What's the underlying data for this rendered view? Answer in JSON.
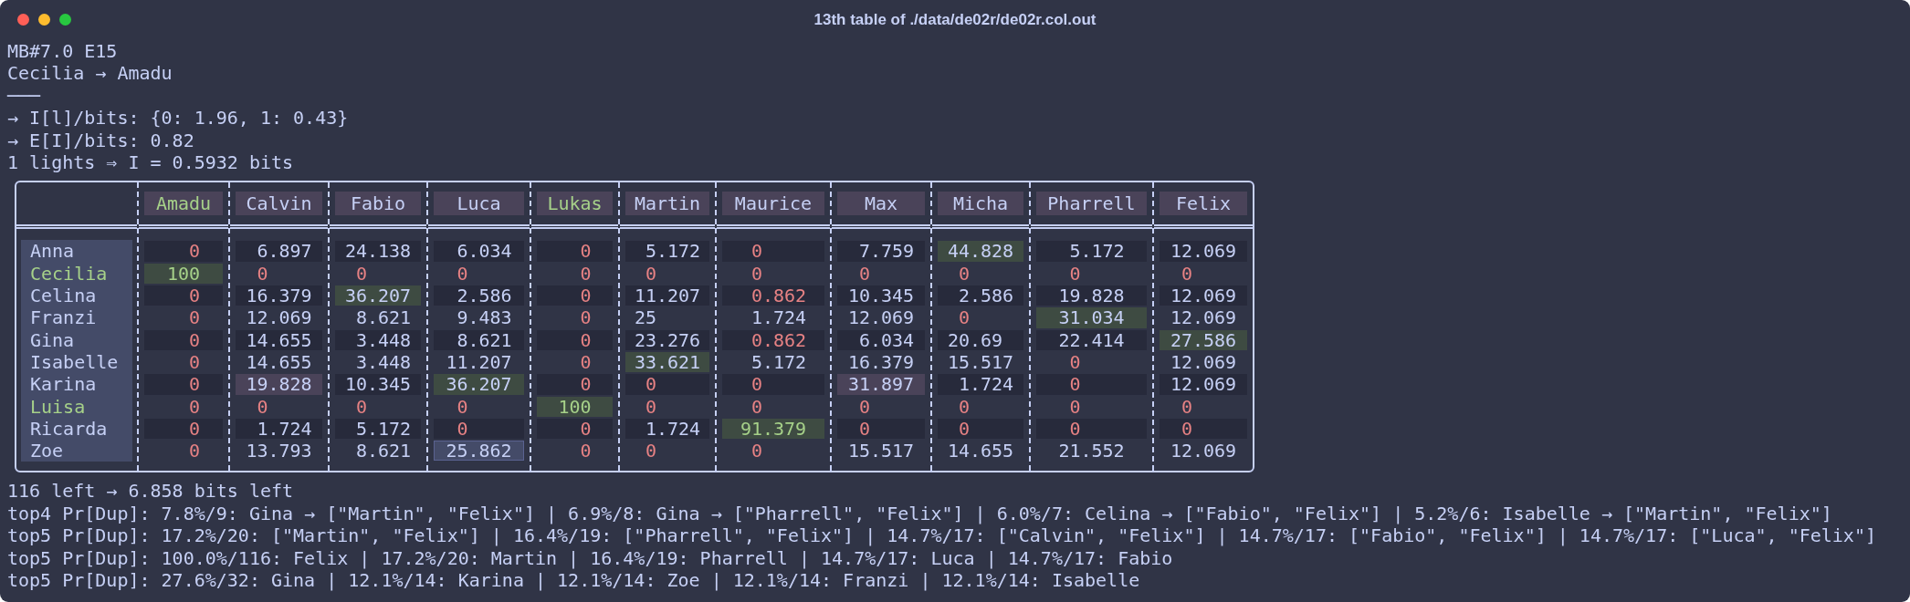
{
  "window": {
    "title": "13th table of ./data/de02r/de02r.col.out"
  },
  "header_lines": [
    "MB#7.0 E15",
    "Cecilia → Amadu",
    "───",
    "→ I[l]/bits: {0: 1.96, 1: 0.43}",
    "→ E[I]/bits: 0.82",
    "1 lights ⇒ I = 0.5932 bits"
  ],
  "table": {
    "columns": [
      {
        "name": "Amadu",
        "match": true
      },
      {
        "name": "Calvin",
        "match": false
      },
      {
        "name": "Fabio",
        "match": false
      },
      {
        "name": "Luca",
        "match": false
      },
      {
        "name": "Lukas",
        "match": true
      },
      {
        "name": "Martin",
        "match": false
      },
      {
        "name": "Maurice",
        "match": false
      },
      {
        "name": "Max",
        "match": false
      },
      {
        "name": "Micha",
        "match": false
      },
      {
        "name": "Pharrell",
        "match": false
      },
      {
        "name": "Felix",
        "match": false
      }
    ],
    "rows": [
      {
        "name": "Anna",
        "match": false,
        "cells": [
          {
            "value": "0",
            "low": true,
            "match": false,
            "best": false,
            "flagged": false,
            "selected": false
          },
          {
            "value": "6.897",
            "low": false,
            "match": false,
            "best": false,
            "flagged": false,
            "selected": false
          },
          {
            "value": "24.138",
            "low": false,
            "match": false,
            "best": false,
            "flagged": false,
            "selected": false
          },
          {
            "value": "6.034",
            "low": false,
            "match": false,
            "best": false,
            "flagged": false,
            "selected": false
          },
          {
            "value": "0",
            "low": true,
            "match": false,
            "best": false,
            "flagged": false,
            "selected": false
          },
          {
            "value": "5.172",
            "low": false,
            "match": false,
            "best": false,
            "flagged": false,
            "selected": false
          },
          {
            "value": "0",
            "low": true,
            "match": false,
            "best": false,
            "flagged": false,
            "selected": false
          },
          {
            "value": "7.759",
            "low": false,
            "match": false,
            "best": false,
            "flagged": false,
            "selected": false
          },
          {
            "value": "44.828",
            "low": false,
            "match": false,
            "best": true,
            "flagged": false,
            "selected": false
          },
          {
            "value": "5.172",
            "low": false,
            "match": false,
            "best": false,
            "flagged": false,
            "selected": false
          },
          {
            "value": "12.069",
            "low": false,
            "match": false,
            "best": false,
            "flagged": false,
            "selected": false
          }
        ]
      },
      {
        "name": "Cecilia",
        "match": true,
        "cells": [
          {
            "value": "100",
            "low": false,
            "match": true,
            "best": true,
            "flagged": false,
            "selected": false
          },
          {
            "value": "0",
            "low": true,
            "match": false,
            "best": false,
            "flagged": false,
            "selected": false
          },
          {
            "value": "0",
            "low": true,
            "match": false,
            "best": false,
            "flagged": false,
            "selected": false
          },
          {
            "value": "0",
            "low": true,
            "match": false,
            "best": false,
            "flagged": false,
            "selected": false
          },
          {
            "value": "0",
            "low": true,
            "match": false,
            "best": false,
            "flagged": false,
            "selected": false
          },
          {
            "value": "0",
            "low": true,
            "match": false,
            "best": false,
            "flagged": false,
            "selected": false
          },
          {
            "value": "0",
            "low": true,
            "match": false,
            "best": false,
            "flagged": false,
            "selected": false
          },
          {
            "value": "0",
            "low": true,
            "match": false,
            "best": false,
            "flagged": false,
            "selected": false
          },
          {
            "value": "0",
            "low": true,
            "match": false,
            "best": false,
            "flagged": false,
            "selected": false
          },
          {
            "value": "0",
            "low": true,
            "match": false,
            "best": false,
            "flagged": false,
            "selected": false
          },
          {
            "value": "0",
            "low": true,
            "match": false,
            "best": false,
            "flagged": false,
            "selected": false
          }
        ]
      },
      {
        "name": "Celina",
        "match": false,
        "cells": [
          {
            "value": "0",
            "low": true,
            "match": false,
            "best": false,
            "flagged": false,
            "selected": false
          },
          {
            "value": "16.379",
            "low": false,
            "match": false,
            "best": false,
            "flagged": false,
            "selected": false
          },
          {
            "value": "36.207",
            "low": false,
            "match": false,
            "best": true,
            "flagged": false,
            "selected": false
          },
          {
            "value": "2.586",
            "low": false,
            "match": false,
            "best": false,
            "flagged": false,
            "selected": false
          },
          {
            "value": "0",
            "low": true,
            "match": false,
            "best": false,
            "flagged": false,
            "selected": false
          },
          {
            "value": "11.207",
            "low": false,
            "match": false,
            "best": false,
            "flagged": false,
            "selected": false
          },
          {
            "value": "0.862",
            "low": true,
            "match": false,
            "best": false,
            "flagged": false,
            "selected": false
          },
          {
            "value": "10.345",
            "low": false,
            "match": false,
            "best": false,
            "flagged": false,
            "selected": false
          },
          {
            "value": "2.586",
            "low": false,
            "match": false,
            "best": false,
            "flagged": false,
            "selected": false
          },
          {
            "value": "19.828",
            "low": false,
            "match": false,
            "best": false,
            "flagged": false,
            "selected": false
          },
          {
            "value": "12.069",
            "low": false,
            "match": false,
            "best": false,
            "flagged": false,
            "selected": false
          }
        ]
      },
      {
        "name": "Franzi",
        "match": false,
        "cells": [
          {
            "value": "0",
            "low": true,
            "match": false,
            "best": false,
            "flagged": false,
            "selected": false
          },
          {
            "value": "12.069",
            "low": false,
            "match": false,
            "best": false,
            "flagged": false,
            "selected": false
          },
          {
            "value": "8.621",
            "low": false,
            "match": false,
            "best": false,
            "flagged": false,
            "selected": false
          },
          {
            "value": "9.483",
            "low": false,
            "match": false,
            "best": false,
            "flagged": false,
            "selected": false
          },
          {
            "value": "0",
            "low": true,
            "match": false,
            "best": false,
            "flagged": false,
            "selected": false
          },
          {
            "value": "25",
            "low": false,
            "match": false,
            "best": false,
            "flagged": false,
            "selected": false
          },
          {
            "value": "1.724",
            "low": false,
            "match": false,
            "best": false,
            "flagged": false,
            "selected": false
          },
          {
            "value": "12.069",
            "low": false,
            "match": false,
            "best": false,
            "flagged": false,
            "selected": false
          },
          {
            "value": "0",
            "low": true,
            "match": false,
            "best": false,
            "flagged": false,
            "selected": false
          },
          {
            "value": "31.034",
            "low": false,
            "match": false,
            "best": true,
            "flagged": false,
            "selected": false
          },
          {
            "value": "12.069",
            "low": false,
            "match": false,
            "best": false,
            "flagged": false,
            "selected": false
          }
        ]
      },
      {
        "name": "Gina",
        "match": false,
        "cells": [
          {
            "value": "0",
            "low": true,
            "match": false,
            "best": false,
            "flagged": false,
            "selected": false
          },
          {
            "value": "14.655",
            "low": false,
            "match": false,
            "best": false,
            "flagged": false,
            "selected": false
          },
          {
            "value": "3.448",
            "low": false,
            "match": false,
            "best": false,
            "flagged": false,
            "selected": false
          },
          {
            "value": "8.621",
            "low": false,
            "match": false,
            "best": false,
            "flagged": false,
            "selected": false
          },
          {
            "value": "0",
            "low": true,
            "match": false,
            "best": false,
            "flagged": false,
            "selected": false
          },
          {
            "value": "23.276",
            "low": false,
            "match": false,
            "best": false,
            "flagged": false,
            "selected": false
          },
          {
            "value": "0.862",
            "low": true,
            "match": false,
            "best": false,
            "flagged": false,
            "selected": false
          },
          {
            "value": "6.034",
            "low": false,
            "match": false,
            "best": false,
            "flagged": false,
            "selected": false
          },
          {
            "value": "20.69",
            "low": false,
            "match": false,
            "best": false,
            "flagged": false,
            "selected": false
          },
          {
            "value": "22.414",
            "low": false,
            "match": false,
            "best": false,
            "flagged": false,
            "selected": false
          },
          {
            "value": "27.586",
            "low": false,
            "match": false,
            "best": true,
            "flagged": false,
            "selected": false
          }
        ]
      },
      {
        "name": "Isabelle",
        "match": false,
        "cells": [
          {
            "value": "0",
            "low": true,
            "match": false,
            "best": false,
            "flagged": false,
            "selected": false
          },
          {
            "value": "14.655",
            "low": false,
            "match": false,
            "best": false,
            "flagged": false,
            "selected": false
          },
          {
            "value": "3.448",
            "low": false,
            "match": false,
            "best": false,
            "flagged": false,
            "selected": false
          },
          {
            "value": "11.207",
            "low": false,
            "match": false,
            "best": false,
            "flagged": false,
            "selected": false
          },
          {
            "value": "0",
            "low": true,
            "match": false,
            "best": false,
            "flagged": false,
            "selected": false
          },
          {
            "value": "33.621",
            "low": false,
            "match": false,
            "best": true,
            "flagged": false,
            "selected": false
          },
          {
            "value": "5.172",
            "low": false,
            "match": false,
            "best": false,
            "flagged": false,
            "selected": false
          },
          {
            "value": "16.379",
            "low": false,
            "match": false,
            "best": false,
            "flagged": false,
            "selected": false
          },
          {
            "value": "15.517",
            "low": false,
            "match": false,
            "best": false,
            "flagged": false,
            "selected": false
          },
          {
            "value": "0",
            "low": true,
            "match": false,
            "best": false,
            "flagged": false,
            "selected": false
          },
          {
            "value": "12.069",
            "low": false,
            "match": false,
            "best": false,
            "flagged": false,
            "selected": false
          }
        ]
      },
      {
        "name": "Karina",
        "match": false,
        "cells": [
          {
            "value": "0",
            "low": true,
            "match": false,
            "best": false,
            "flagged": false,
            "selected": false
          },
          {
            "value": "19.828",
            "low": false,
            "match": false,
            "best": false,
            "flagged": true,
            "selected": false
          },
          {
            "value": "10.345",
            "low": false,
            "match": false,
            "best": false,
            "flagged": false,
            "selected": false
          },
          {
            "value": "36.207",
            "low": false,
            "match": false,
            "best": true,
            "flagged": false,
            "selected": false
          },
          {
            "value": "0",
            "low": true,
            "match": false,
            "best": false,
            "flagged": false,
            "selected": false
          },
          {
            "value": "0",
            "low": true,
            "match": false,
            "best": false,
            "flagged": false,
            "selected": false
          },
          {
            "value": "0",
            "low": true,
            "match": false,
            "best": false,
            "flagged": false,
            "selected": false
          },
          {
            "value": "31.897",
            "low": false,
            "match": false,
            "best": false,
            "flagged": true,
            "selected": false
          },
          {
            "value": "1.724",
            "low": false,
            "match": false,
            "best": false,
            "flagged": false,
            "selected": false
          },
          {
            "value": "0",
            "low": true,
            "match": false,
            "best": false,
            "flagged": false,
            "selected": false
          },
          {
            "value": "12.069",
            "low": false,
            "match": false,
            "best": false,
            "flagged": false,
            "selected": false
          }
        ]
      },
      {
        "name": "Luisa",
        "match": true,
        "cells": [
          {
            "value": "0",
            "low": true,
            "match": false,
            "best": false,
            "flagged": false,
            "selected": false
          },
          {
            "value": "0",
            "low": true,
            "match": false,
            "best": false,
            "flagged": false,
            "selected": false
          },
          {
            "value": "0",
            "low": true,
            "match": false,
            "best": false,
            "flagged": false,
            "selected": false
          },
          {
            "value": "0",
            "low": true,
            "match": false,
            "best": false,
            "flagged": false,
            "selected": false
          },
          {
            "value": "100",
            "low": false,
            "match": true,
            "best": true,
            "flagged": false,
            "selected": false
          },
          {
            "value": "0",
            "low": true,
            "match": false,
            "best": false,
            "flagged": false,
            "selected": false
          },
          {
            "value": "0",
            "low": true,
            "match": false,
            "best": false,
            "flagged": false,
            "selected": false
          },
          {
            "value": "0",
            "low": true,
            "match": false,
            "best": false,
            "flagged": false,
            "selected": false
          },
          {
            "value": "0",
            "low": true,
            "match": false,
            "best": false,
            "flagged": false,
            "selected": false
          },
          {
            "value": "0",
            "low": true,
            "match": false,
            "best": false,
            "flagged": false,
            "selected": false
          },
          {
            "value": "0",
            "low": true,
            "match": false,
            "best": false,
            "flagged": false,
            "selected": false
          }
        ]
      },
      {
        "name": "Ricarda",
        "match": false,
        "cells": [
          {
            "value": "0",
            "low": true,
            "match": false,
            "best": false,
            "flagged": false,
            "selected": false
          },
          {
            "value": "1.724",
            "low": false,
            "match": false,
            "best": false,
            "flagged": false,
            "selected": false
          },
          {
            "value": "5.172",
            "low": false,
            "match": false,
            "best": false,
            "flagged": false,
            "selected": false
          },
          {
            "value": "0",
            "low": true,
            "match": false,
            "best": false,
            "flagged": false,
            "selected": false
          },
          {
            "value": "0",
            "low": true,
            "match": false,
            "best": false,
            "flagged": false,
            "selected": false
          },
          {
            "value": "1.724",
            "low": false,
            "match": false,
            "best": false,
            "flagged": false,
            "selected": false
          },
          {
            "value": "91.379",
            "low": false,
            "match": true,
            "best": true,
            "flagged": false,
            "selected": false
          },
          {
            "value": "0",
            "low": true,
            "match": false,
            "best": false,
            "flagged": false,
            "selected": false
          },
          {
            "value": "0",
            "low": true,
            "match": false,
            "best": false,
            "flagged": false,
            "selected": false
          },
          {
            "value": "0",
            "low": true,
            "match": false,
            "best": false,
            "flagged": false,
            "selected": false
          },
          {
            "value": "0",
            "low": true,
            "match": false,
            "best": false,
            "flagged": false,
            "selected": false
          }
        ]
      },
      {
        "name": "Zoe",
        "match": false,
        "cells": [
          {
            "value": "0",
            "low": true,
            "match": false,
            "best": false,
            "flagged": false,
            "selected": false
          },
          {
            "value": "13.793",
            "low": false,
            "match": false,
            "best": false,
            "flagged": false,
            "selected": false
          },
          {
            "value": "8.621",
            "low": false,
            "match": false,
            "best": false,
            "flagged": false,
            "selected": false
          },
          {
            "value": "25.862",
            "low": false,
            "match": false,
            "best": false,
            "flagged": false,
            "selected": true
          },
          {
            "value": "0",
            "low": true,
            "match": false,
            "best": false,
            "flagged": false,
            "selected": false
          },
          {
            "value": "0",
            "low": true,
            "match": false,
            "best": false,
            "flagged": false,
            "selected": false
          },
          {
            "value": "0",
            "low": true,
            "match": false,
            "best": false,
            "flagged": false,
            "selected": false
          },
          {
            "value": "15.517",
            "low": false,
            "match": false,
            "best": false,
            "flagged": false,
            "selected": false
          },
          {
            "value": "14.655",
            "low": false,
            "match": false,
            "best": false,
            "flagged": false,
            "selected": false
          },
          {
            "value": "21.552",
            "low": false,
            "match": false,
            "best": false,
            "flagged": false,
            "selected": false
          },
          {
            "value": "12.069",
            "low": false,
            "match": false,
            "best": false,
            "flagged": false,
            "selected": false
          }
        ]
      }
    ]
  },
  "footer_lines": [
    "116 left → 6.858 bits left",
    "top4 Pr[Dup]: 7.8%/9: Gina → [\"Martin\", \"Felix\"] | 6.9%/8: Gina → [\"Pharrell\", \"Felix\"] | 6.0%/7: Celina → [\"Fabio\", \"Felix\"] | 5.2%/6: Isabelle → [\"Martin\", \"Felix\"]",
    "top5 Pr[Dup]: 17.2%/20: [\"Martin\", \"Felix\"] | 16.4%/19: [\"Pharrell\", \"Felix\"] | 14.7%/17: [\"Calvin\", \"Felix\"] | 14.7%/17: [\"Fabio\", \"Felix\"] | 14.7%/17: [\"Luca\", \"Felix\"]",
    "top5 Pr[Dup]: 100.0%/116: Felix | 17.2%/20: Martin | 16.4%/19: Pharrell | 14.7%/17: Luca | 14.7%/17: Fabio",
    "top5 Pr[Dup]: 27.6%/32: Gina | 12.1%/14: Karina | 12.1%/14: Zoe | 12.1%/14: Franzi | 12.1%/14: Isabelle"
  ]
}
